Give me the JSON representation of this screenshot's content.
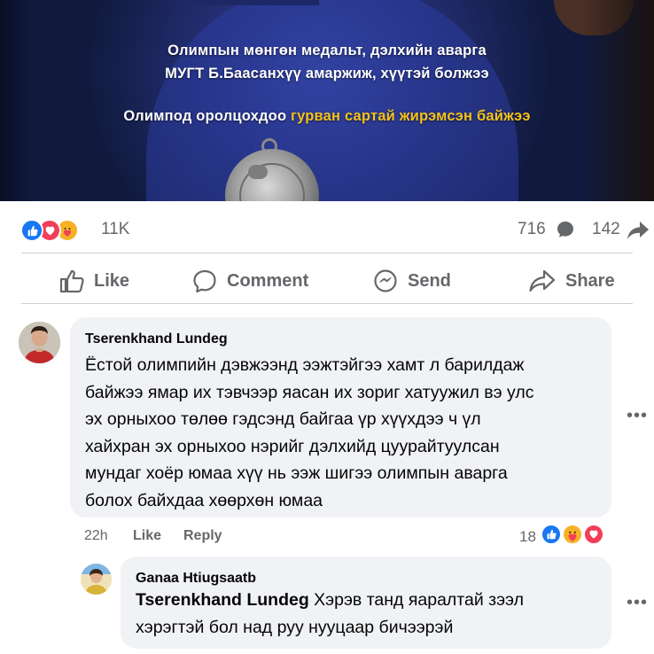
{
  "banner": {
    "line1": "Олимпын мөнгөн медальт, дэлхийн аварга",
    "line2": "МУГТ Б.Баасанхүү амаржиж, хүүтэй болжээ",
    "line3_prefix": "Олимпод оролцохдоо ",
    "line3_highlight": "гурван сартай жирэмсэн байжээ",
    "highlight_color": "#f4c21c"
  },
  "stats": {
    "reactions_count": "11K",
    "comments_count": "716",
    "shares_count": "142",
    "reaction_icons": [
      "like-icon",
      "love-icon",
      "care-icon"
    ]
  },
  "actions": {
    "like": "Like",
    "comment": "Comment",
    "send": "Send",
    "share": "Share"
  },
  "comments": [
    {
      "author": "Tserenkhand Lundeg",
      "lines": [
        "Ёстой олимпийн дэвжээнд ээжтэйгээ хамт л барилдаж",
        "байжээ ямар их тэвчээр яасан их зориг хатуужил вэ улс",
        "эх орныхоо төлөө гэдсэнд байгаа үр хүүхдээ ч үл",
        "хайхран эх орныхоо нэрийг дэлхийд цуурайтуулсан",
        "мундаг хоёр юмаа хүү нь ээж шигээ олимпын аварга",
        "болох байхдаа хөөрхөн юмаа"
      ],
      "time": "22h",
      "like_label": "Like",
      "reply_label": "Reply",
      "reaction_count": "18",
      "more": "•••"
    },
    {
      "author": "Ganaa Htiugsaatb",
      "mention": "Tserenkhand Lundeg",
      "line1_rest": " Хэрэв танд яаралтай зээл",
      "line2": "хэрэгтэй бол над руу нууцаар бичээрэй",
      "more": "•••"
    }
  ],
  "colors": {
    "facebook_blue": "#1877f2",
    "love_red": "#f33e58",
    "care_yellow": "#f7b125",
    "secondary_text": "#65676b",
    "bubble_bg": "#f0f2f5"
  }
}
